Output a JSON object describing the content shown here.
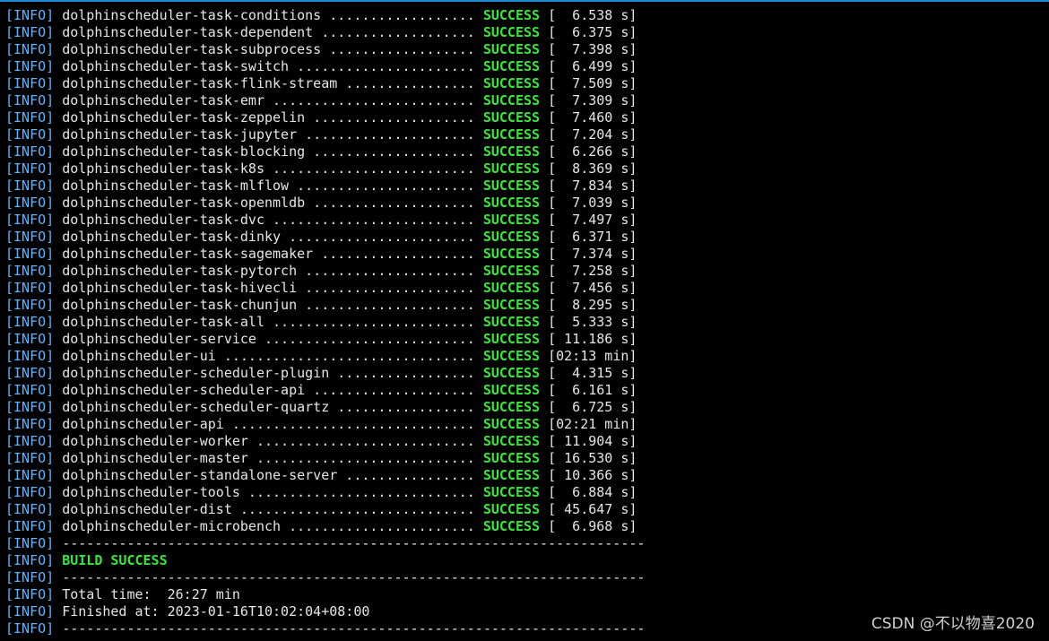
{
  "log": {
    "tag": "[INFO]",
    "modules": [
      {
        "name": "dolphinscheduler-task-conditions",
        "dots": " ..................",
        "status": "SUCCESS",
        "time": " [  6.538 s]"
      },
      {
        "name": "dolphinscheduler-task-dependent",
        "dots": " ...................",
        "status": "SUCCESS",
        "time": " [  6.375 s]"
      },
      {
        "name": "dolphinscheduler-task-subprocess",
        "dots": " ..................",
        "status": "SUCCESS",
        "time": " [  7.398 s]"
      },
      {
        "name": "dolphinscheduler-task-switch",
        "dots": " ......................",
        "status": "SUCCESS",
        "time": " [  6.499 s]"
      },
      {
        "name": "dolphinscheduler-task-flink-stream",
        "dots": " ................",
        "status": "SUCCESS",
        "time": " [  7.509 s]"
      },
      {
        "name": "dolphinscheduler-task-emr",
        "dots": " .........................",
        "status": "SUCCESS",
        "time": " [  7.309 s]"
      },
      {
        "name": "dolphinscheduler-task-zeppelin",
        "dots": " ....................",
        "status": "SUCCESS",
        "time": " [  7.460 s]"
      },
      {
        "name": "dolphinscheduler-task-jupyter",
        "dots": " .....................",
        "status": "SUCCESS",
        "time": " [  7.204 s]"
      },
      {
        "name": "dolphinscheduler-task-blocking",
        "dots": " ....................",
        "status": "SUCCESS",
        "time": " [  6.266 s]"
      },
      {
        "name": "dolphinscheduler-task-k8s",
        "dots": " .........................",
        "status": "SUCCESS",
        "time": " [  8.369 s]"
      },
      {
        "name": "dolphinscheduler-task-mlflow",
        "dots": " ......................",
        "status": "SUCCESS",
        "time": " [  7.834 s]"
      },
      {
        "name": "dolphinscheduler-task-openmldb",
        "dots": " ....................",
        "status": "SUCCESS",
        "time": " [  7.039 s]"
      },
      {
        "name": "dolphinscheduler-task-dvc",
        "dots": " .........................",
        "status": "SUCCESS",
        "time": " [  7.497 s]"
      },
      {
        "name": "dolphinscheduler-task-dinky",
        "dots": " .......................",
        "status": "SUCCESS",
        "time": " [  6.371 s]"
      },
      {
        "name": "dolphinscheduler-task-sagemaker",
        "dots": " ...................",
        "status": "SUCCESS",
        "time": " [  7.374 s]"
      },
      {
        "name": "dolphinscheduler-task-pytorch",
        "dots": " .....................",
        "status": "SUCCESS",
        "time": " [  7.258 s]"
      },
      {
        "name": "dolphinscheduler-task-hivecli",
        "dots": " .....................",
        "status": "SUCCESS",
        "time": " [  7.456 s]"
      },
      {
        "name": "dolphinscheduler-task-chunjun",
        "dots": " .....................",
        "status": "SUCCESS",
        "time": " [  8.295 s]"
      },
      {
        "name": "dolphinscheduler-task-all",
        "dots": " .........................",
        "status": "SUCCESS",
        "time": " [  5.333 s]"
      },
      {
        "name": "dolphinscheduler-service",
        "dots": " ..........................",
        "status": "SUCCESS",
        "time": " [ 11.186 s]"
      },
      {
        "name": "dolphinscheduler-ui",
        "dots": " ...............................",
        "status": "SUCCESS",
        "time": " [02:13 min]"
      },
      {
        "name": "dolphinscheduler-scheduler-plugin",
        "dots": " .................",
        "status": "SUCCESS",
        "time": " [  4.315 s]"
      },
      {
        "name": "dolphinscheduler-scheduler-api",
        "dots": " ....................",
        "status": "SUCCESS",
        "time": " [  6.161 s]"
      },
      {
        "name": "dolphinscheduler-scheduler-quartz",
        "dots": " .................",
        "status": "SUCCESS",
        "time": " [  6.725 s]"
      },
      {
        "name": "dolphinscheduler-api",
        "dots": " ..............................",
        "status": "SUCCESS",
        "time": " [02:21 min]"
      },
      {
        "name": "dolphinscheduler-worker",
        "dots": " ...........................",
        "status": "SUCCESS",
        "time": " [ 11.904 s]"
      },
      {
        "name": "dolphinscheduler-master",
        "dots": " ...........................",
        "status": "SUCCESS",
        "time": " [ 16.530 s]"
      },
      {
        "name": "dolphinscheduler-standalone-server",
        "dots": " ................",
        "status": "SUCCESS",
        "time": " [ 10.366 s]"
      },
      {
        "name": "dolphinscheduler-tools",
        "dots": " ............................",
        "status": "SUCCESS",
        "time": " [  6.884 s]"
      },
      {
        "name": "dolphinscheduler-dist",
        "dots": " .............................",
        "status": "SUCCESS",
        "time": " [ 45.647 s]"
      },
      {
        "name": "dolphinscheduler-microbench",
        "dots": " .......................",
        "status": "SUCCESS",
        "time": " [  6.968 s]"
      }
    ],
    "separator": " ------------------------------------------------------------------------",
    "build_status": " BUILD SUCCESS",
    "total_time": " Total time:  26:27 min",
    "finished_at": " Finished at: 2023-01-16T10:02:04+08:00"
  },
  "watermark": "CSDN @不以物喜2020",
  "colors": {
    "background": "#000000",
    "text": "#e6e6e6",
    "info_tag": "#5fb4ff",
    "success": "#39e639",
    "window_border": "#1e88d8"
  }
}
